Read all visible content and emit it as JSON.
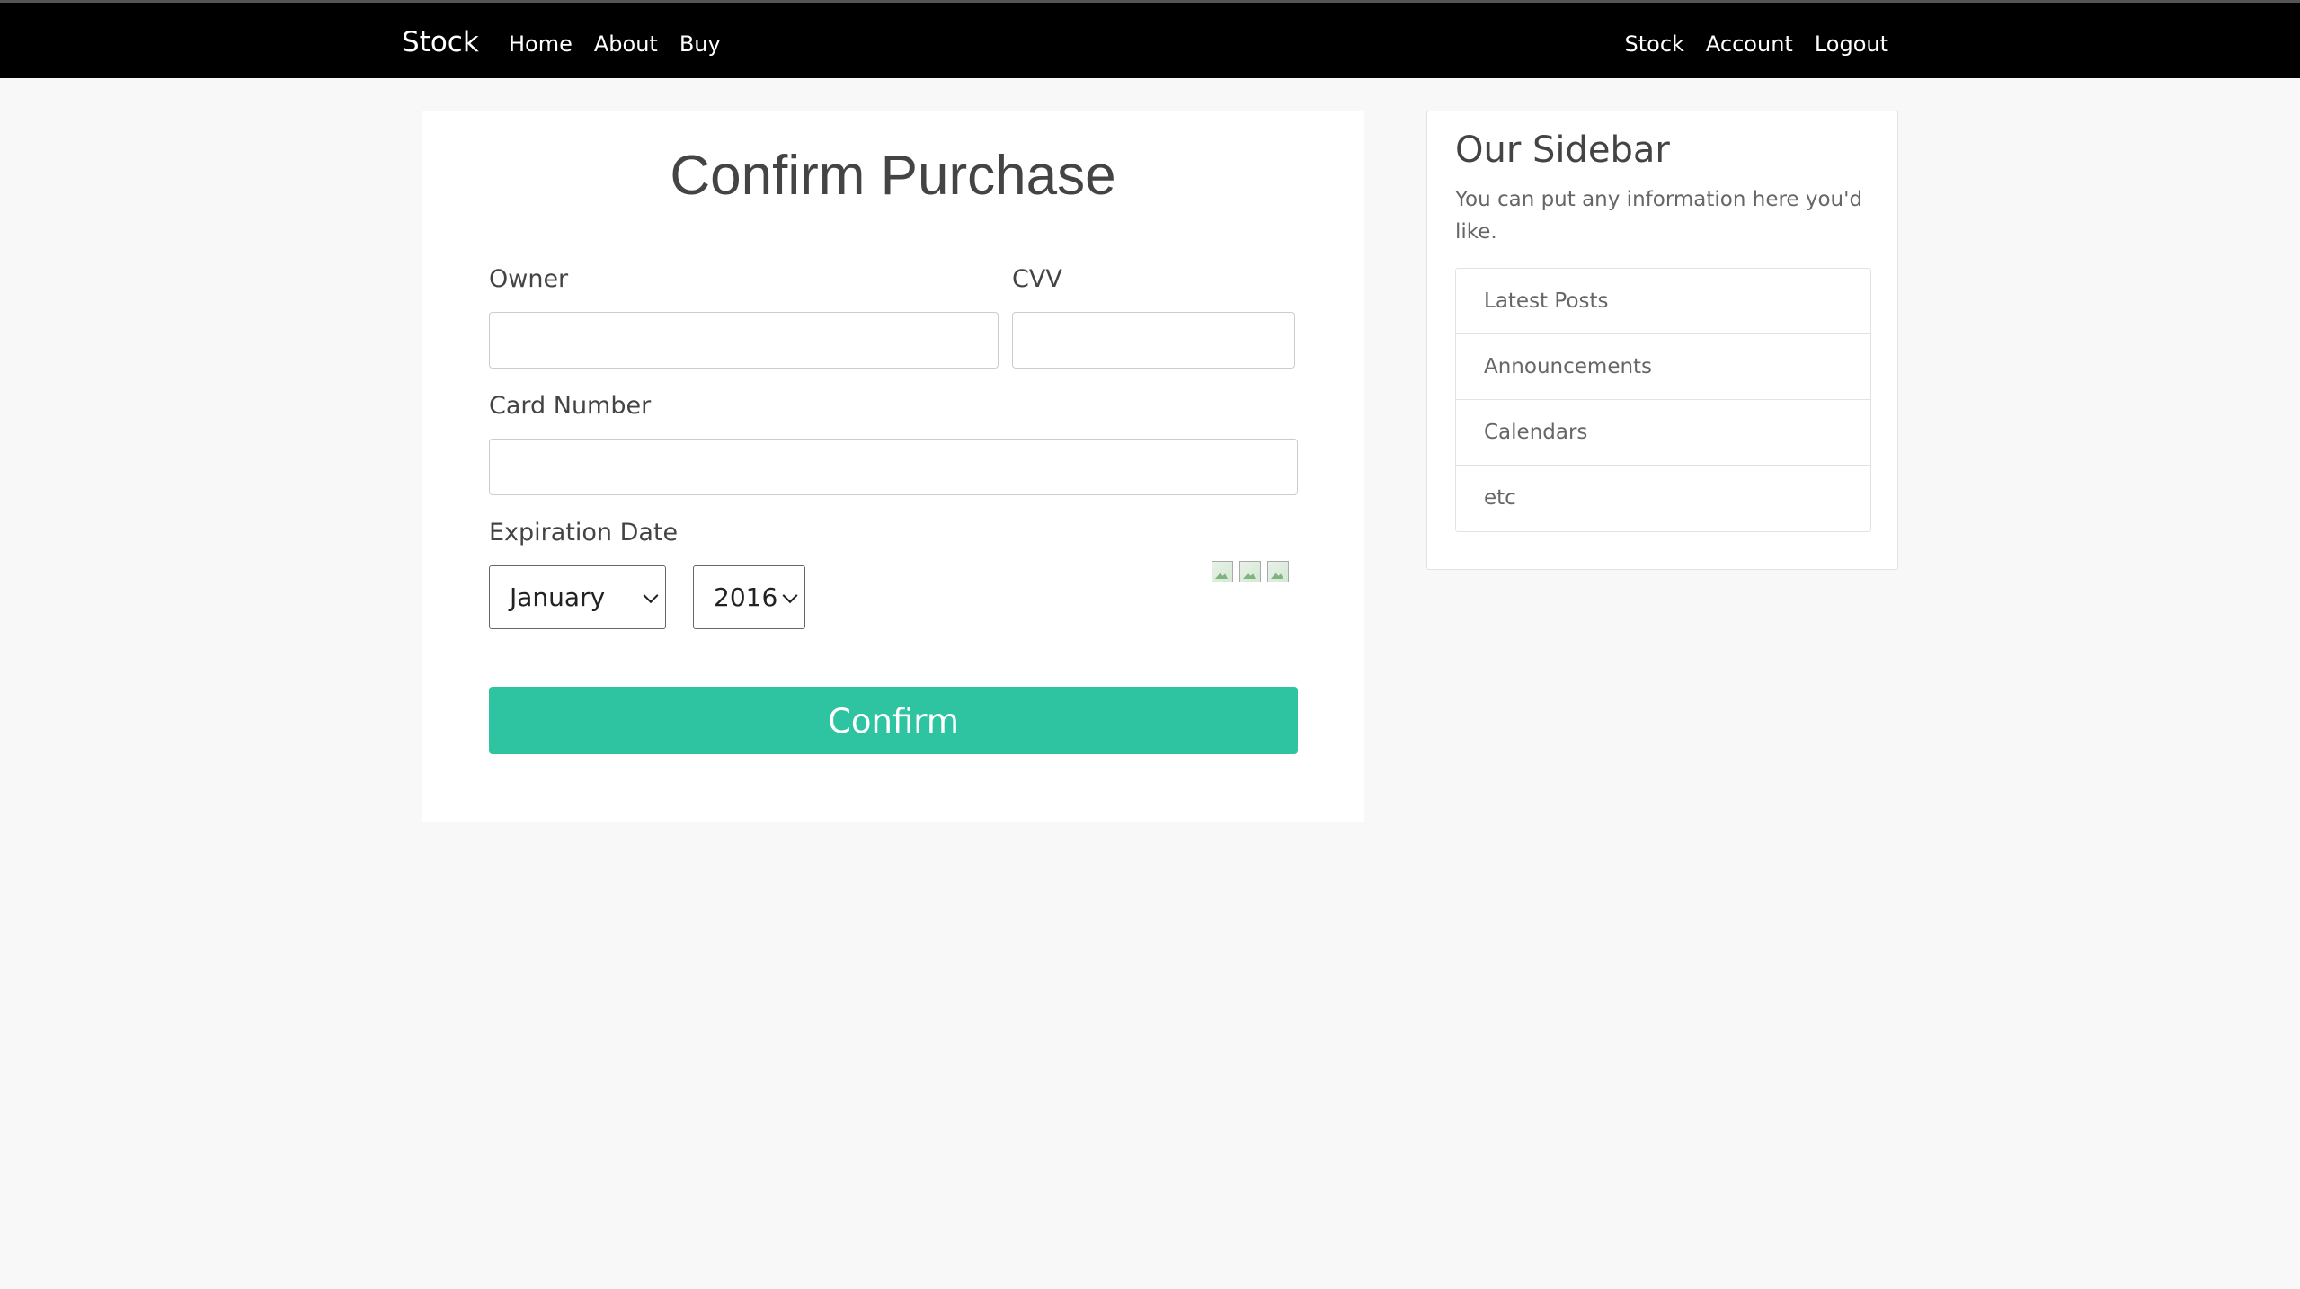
{
  "navbar": {
    "brand": "Stock",
    "left_links": [
      "Home",
      "About",
      "Buy"
    ],
    "right_links": [
      "Stock",
      "Account",
      "Logout"
    ]
  },
  "form": {
    "title": "Confirm Purchase",
    "owner_label": "Owner",
    "owner_value": "",
    "cvv_label": "CVV",
    "cvv_value": "",
    "card_number_label": "Card Number",
    "card_number_value": "",
    "expiration_label": "Expiration Date",
    "month_selected": "January",
    "year_selected": "2016",
    "card_icons": [
      "broken-image-icon",
      "broken-image-icon",
      "broken-image-icon"
    ],
    "confirm_label": "Confirm",
    "confirm_color": "#2ec4a2"
  },
  "sidebar": {
    "title": "Our Sidebar",
    "description": "You can put any information here you'd like.",
    "items": [
      "Latest Posts",
      "Announcements",
      "Calendars",
      "etc"
    ]
  }
}
